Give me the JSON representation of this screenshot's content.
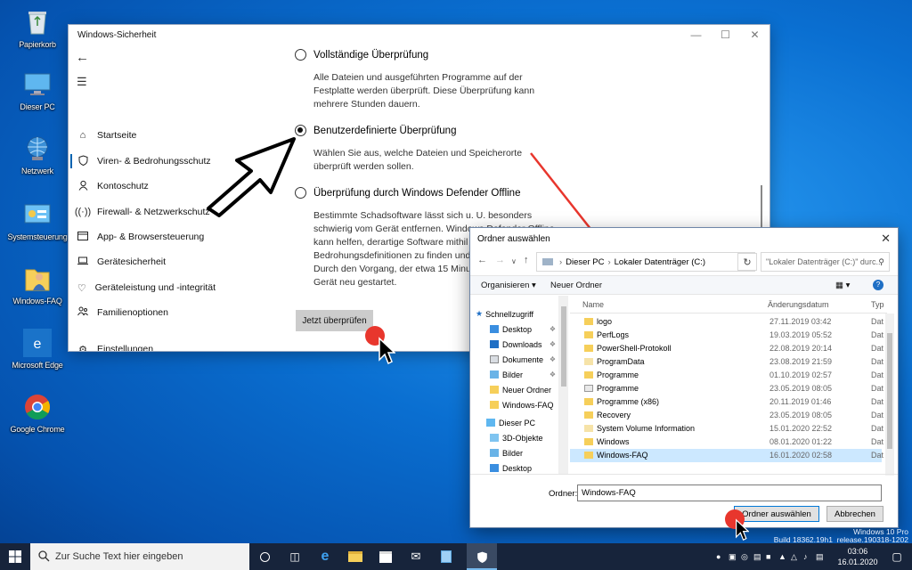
{
  "desktop": {
    "icons": [
      {
        "label": "Papierkorb",
        "icon": "recycle-bin-icon"
      },
      {
        "label": "Dieser PC",
        "icon": "this-pc-icon"
      },
      {
        "label": "Netzwerk",
        "icon": "network-icon"
      },
      {
        "label": "Systemsteuerung",
        "icon": "control-panel-icon"
      },
      {
        "label": "Windows-FAQ",
        "icon": "user-folder-icon"
      },
      {
        "label": "Microsoft Edge",
        "icon": "edge-icon"
      },
      {
        "label": "Google Chrome",
        "icon": "chrome-icon"
      }
    ]
  },
  "security_window": {
    "title": "Windows-Sicherheit",
    "nav": [
      {
        "label": "Startseite",
        "icon": "home-icon"
      },
      {
        "label": "Viren- & Bedrohungsschutz",
        "icon": "shield-icon",
        "active": true
      },
      {
        "label": "Kontoschutz",
        "icon": "person-icon"
      },
      {
        "label": "Firewall- & Netzwerkschutz",
        "icon": "wifi-icon"
      },
      {
        "label": "App- & Browsersteuerung",
        "icon": "browser-icon"
      },
      {
        "label": "Gerätesicherheit",
        "icon": "laptop-icon"
      },
      {
        "label": "Geräteleistung und -integrität",
        "icon": "heart-icon"
      },
      {
        "label": "Familienoptionen",
        "icon": "family-icon"
      },
      {
        "label": "Einstellungen",
        "icon": "gear-icon"
      }
    ],
    "options": [
      {
        "label": "Vollständige Überprüfung",
        "selected": false,
        "desc": [
          "Alle Dateien und ausgeführten Programme auf der",
          "Festplatte werden überprüft. Diese Überprüfung kann",
          "mehrere Stunden dauern."
        ]
      },
      {
        "label": "Benutzerdefinierte Überprüfung",
        "selected": true,
        "desc": [
          "Wählen Sie aus, welche Dateien und Speicherorte",
          "überprüft werden sollen."
        ]
      },
      {
        "label": "Überprüfung durch Windows Defender Offline",
        "selected": false,
        "desc": [
          "Bestimmte Schadsoftware lässt sich u. U. besonders",
          "schwierig vom Gerät entfernen. Windows Defender Offline",
          "kann helfen, derartige Software mithil",
          "Bedrohungsdefinitionen zu finden und",
          "Durch den Vorgang, der etwa 15 Minu",
          "Gerät neu gestartet."
        ]
      }
    ],
    "scan_button": "Jetzt überprüfen"
  },
  "folder_dialog": {
    "title": "Ordner auswählen",
    "breadcrumb": [
      "Dieser PC",
      "Lokaler Datenträger (C:)"
    ],
    "search_placeholder": "\"Lokaler Datenträger (C:)\" durc...",
    "toolbar": {
      "organize": "Organisieren",
      "new_folder": "Neuer Ordner"
    },
    "tree": [
      {
        "label": "Schnellzugriff",
        "icon": "star-icon",
        "pinned": false
      },
      {
        "label": "Desktop",
        "icon": "desktop-folder-icon",
        "pinned": true
      },
      {
        "label": "Downloads",
        "icon": "download-folder-icon",
        "pinned": true
      },
      {
        "label": "Dokumente",
        "icon": "documents-folder-icon",
        "pinned": true
      },
      {
        "label": "Bilder",
        "icon": "pictures-folder-icon",
        "pinned": true
      },
      {
        "label": "Neuer Ordner",
        "icon": "folder-icon",
        "pinned": false
      },
      {
        "label": "Windows-FAQ",
        "icon": "folder-icon",
        "pinned": false
      },
      {
        "label": "Dieser PC",
        "icon": "pc-icon",
        "pinned": false
      },
      {
        "label": "3D-Objekte",
        "icon": "3d-folder-icon",
        "pinned": false
      },
      {
        "label": "Bilder",
        "icon": "pictures-folder-icon",
        "pinned": false
      },
      {
        "label": "Desktop",
        "icon": "desktop-folder-icon",
        "pinned": false
      }
    ],
    "columns": {
      "name": "Name",
      "date": "Änderungsdatum",
      "type": "Typ"
    },
    "rows": [
      {
        "name": "logo",
        "date": "27.11.2019 03:42",
        "type": "Dat"
      },
      {
        "name": "PerfLogs",
        "date": "19.03.2019 05:52",
        "type": "Dat"
      },
      {
        "name": "PowerShell-Protokoll",
        "date": "22.08.2019 20:14",
        "type": "Dat"
      },
      {
        "name": "ProgramData",
        "date": "23.08.2019 21:59",
        "type": "Dat"
      },
      {
        "name": "Programme",
        "date": "01.10.2019 02:57",
        "type": "Dat"
      },
      {
        "name": "Programme",
        "date": "23.05.2019 08:05",
        "type": "Dat"
      },
      {
        "name": "Programme (x86)",
        "date": "20.11.2019 01:46",
        "type": "Dat"
      },
      {
        "name": "Recovery",
        "date": "23.05.2019 08:05",
        "type": "Dat"
      },
      {
        "name": "System Volume Information",
        "date": "15.01.2020 22:52",
        "type": "Dat"
      },
      {
        "name": "Windows",
        "date": "08.01.2020 01:22",
        "type": "Dat"
      },
      {
        "name": "Windows-FAQ",
        "date": "16.01.2020 02:58",
        "type": "Dat",
        "selected": true
      }
    ],
    "folder_label": "Ordner:",
    "folder_value": "Windows-FAQ",
    "ok_button": "Ordner auswählen",
    "cancel_button": "Abbrechen"
  },
  "watermark": {
    "line1": "Windows 10 Pro",
    "line2": "Build 18362.19h1_release.190318-1202"
  },
  "taskbar": {
    "search_placeholder": "Zur Suche Text hier eingeben",
    "clock_time": "03:06",
    "clock_date": "16.01.2020"
  },
  "colors": {
    "accent": "#0078d7",
    "annotation_red": "#e8362d",
    "taskbar": "#17243b"
  }
}
